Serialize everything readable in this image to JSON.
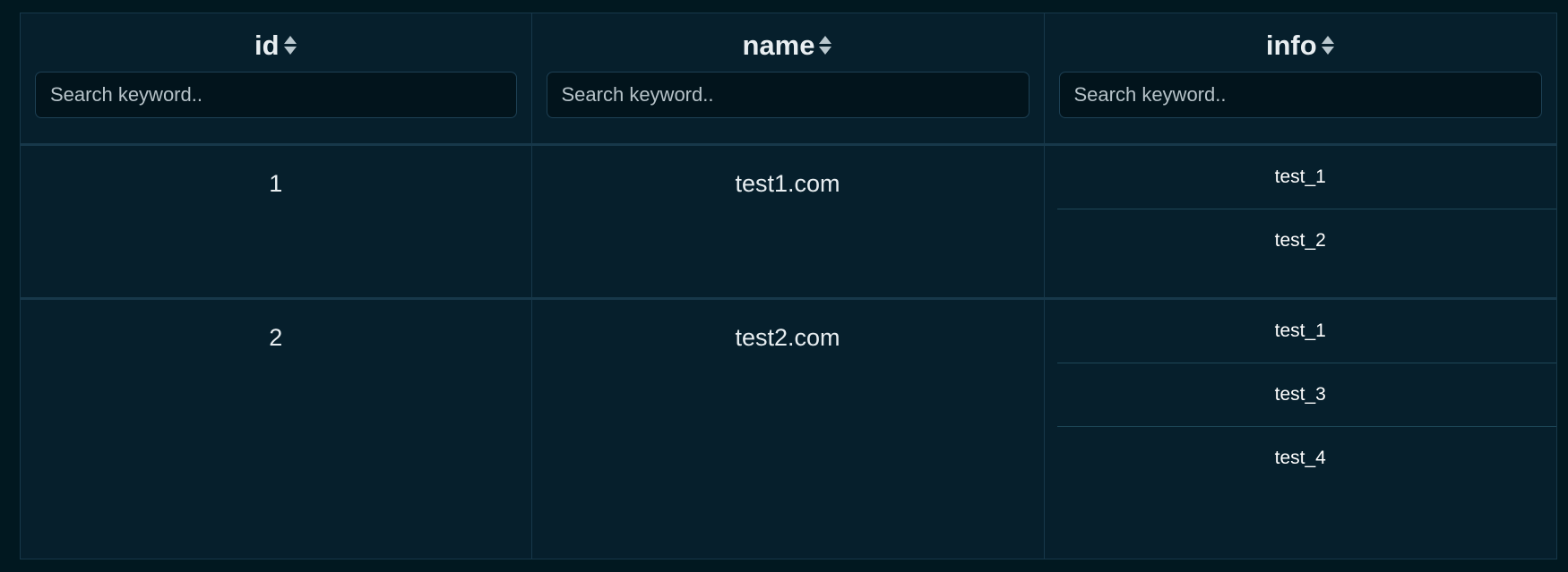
{
  "theme": {
    "page_background": "#011820",
    "cell_background": "#061f2c",
    "border_color": "#17384a",
    "input_background": "#02141c",
    "input_border": "#1d4054",
    "text_primary": "#e8eef1",
    "text_secondary": "#ffffff",
    "placeholder_color": "#b6c2c8",
    "sort_icon_color": "#b9c7ce",
    "info_divider": "#1d4757"
  },
  "table": {
    "columns": [
      {
        "key": "id",
        "label": "id",
        "sort_icon": "sort-updown-icon",
        "search": {
          "value": "",
          "placeholder": "Search keyword.."
        }
      },
      {
        "key": "name",
        "label": "name",
        "sort_icon": "sort-updown-icon",
        "search": {
          "value": "",
          "placeholder": "Search keyword.."
        }
      },
      {
        "key": "info",
        "label": "info",
        "sort_icon": "sort-updown-icon",
        "search": {
          "value": "",
          "placeholder": "Search keyword.."
        }
      }
    ],
    "rows": [
      {
        "id": "1",
        "name": "test1.com",
        "info": [
          "test_1",
          "test_2"
        ]
      },
      {
        "id": "2",
        "name": "test2.com",
        "info": [
          "test_1",
          "test_3",
          "test_4"
        ]
      }
    ]
  }
}
